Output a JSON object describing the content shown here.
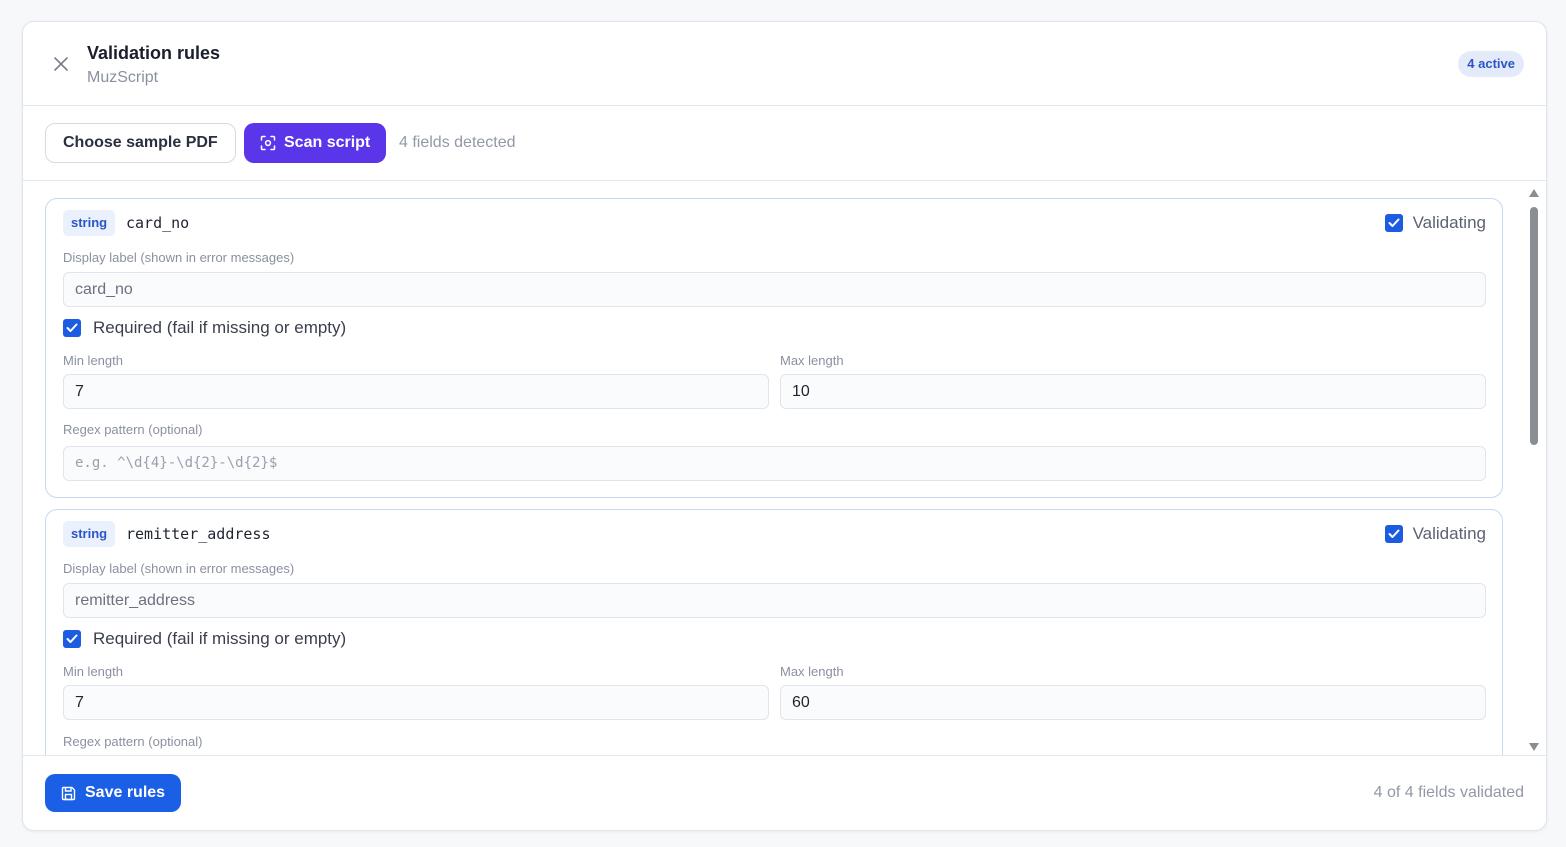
{
  "header": {
    "title": "Validation rules",
    "subtitle": "MuzScript",
    "active_badge": "4 active"
  },
  "toolbar": {
    "choose_sample_label": "Choose sample PDF",
    "scan_label": "Scan script",
    "fields_detected": "4 fields detected"
  },
  "fields": [
    {
      "type": "string",
      "key": "card_no",
      "validating_label": "Validating",
      "validating_checked": true,
      "display_label_caption": "Display label (shown in error messages)",
      "display_label_value": "card_no",
      "required_label": "Required (fail if missing or empty)",
      "required_checked": true,
      "min_length_caption": "Min length",
      "min_length_value": "7",
      "max_length_caption": "Max length",
      "max_length_value": "10",
      "regex_caption": "Regex pattern (optional)",
      "regex_placeholder": "e.g. ^\\d{4}-\\d{2}-\\d{2}$"
    },
    {
      "type": "string",
      "key": "remitter_address",
      "validating_label": "Validating",
      "validating_checked": true,
      "display_label_caption": "Display label (shown in error messages)",
      "display_label_value": "remitter_address",
      "required_label": "Required (fail if missing or empty)",
      "required_checked": true,
      "min_length_caption": "Min length",
      "min_length_value": "7",
      "max_length_caption": "Max length",
      "max_length_value": "60",
      "regex_caption": "Regex pattern (optional)"
    }
  ],
  "footer": {
    "save_label": "Save rules",
    "validated_count": "4 of 4 fields validated"
  },
  "colors": {
    "primary": "#1a5fe6",
    "scan_accent": "#5b35ea",
    "card_border": "#c7d7f4",
    "badge_bg": "#e3ebfb"
  },
  "icons": {
    "close": "close-icon",
    "scan": "scan-icon",
    "save": "save-icon",
    "checkbox": "checkbox-checked-icon"
  }
}
